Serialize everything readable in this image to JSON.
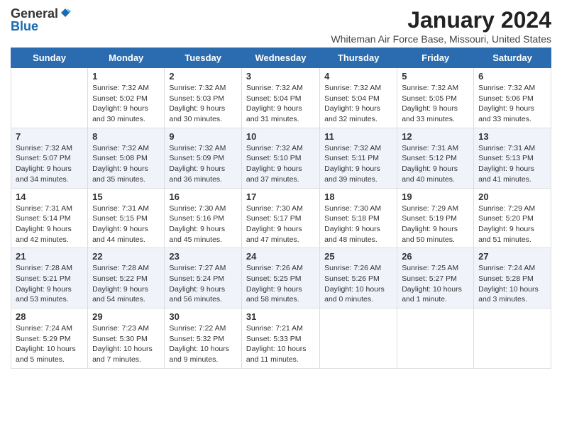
{
  "header": {
    "logo_general": "General",
    "logo_blue": "Blue",
    "title": "January 2024",
    "subtitle": "Whiteman Air Force Base, Missouri, United States"
  },
  "columns": [
    "Sunday",
    "Monday",
    "Tuesday",
    "Wednesday",
    "Thursday",
    "Friday",
    "Saturday"
  ],
  "weeks": [
    {
      "days": [
        {
          "number": "",
          "info": ""
        },
        {
          "number": "1",
          "info": "Sunrise: 7:32 AM\nSunset: 5:02 PM\nDaylight: 9 hours\nand 30 minutes."
        },
        {
          "number": "2",
          "info": "Sunrise: 7:32 AM\nSunset: 5:03 PM\nDaylight: 9 hours\nand 30 minutes."
        },
        {
          "number": "3",
          "info": "Sunrise: 7:32 AM\nSunset: 5:04 PM\nDaylight: 9 hours\nand 31 minutes."
        },
        {
          "number": "4",
          "info": "Sunrise: 7:32 AM\nSunset: 5:04 PM\nDaylight: 9 hours\nand 32 minutes."
        },
        {
          "number": "5",
          "info": "Sunrise: 7:32 AM\nSunset: 5:05 PM\nDaylight: 9 hours\nand 33 minutes."
        },
        {
          "number": "6",
          "info": "Sunrise: 7:32 AM\nSunset: 5:06 PM\nDaylight: 9 hours\nand 33 minutes."
        }
      ]
    },
    {
      "days": [
        {
          "number": "7",
          "info": "Sunrise: 7:32 AM\nSunset: 5:07 PM\nDaylight: 9 hours\nand 34 minutes."
        },
        {
          "number": "8",
          "info": "Sunrise: 7:32 AM\nSunset: 5:08 PM\nDaylight: 9 hours\nand 35 minutes."
        },
        {
          "number": "9",
          "info": "Sunrise: 7:32 AM\nSunset: 5:09 PM\nDaylight: 9 hours\nand 36 minutes."
        },
        {
          "number": "10",
          "info": "Sunrise: 7:32 AM\nSunset: 5:10 PM\nDaylight: 9 hours\nand 37 minutes."
        },
        {
          "number": "11",
          "info": "Sunrise: 7:32 AM\nSunset: 5:11 PM\nDaylight: 9 hours\nand 39 minutes."
        },
        {
          "number": "12",
          "info": "Sunrise: 7:31 AM\nSunset: 5:12 PM\nDaylight: 9 hours\nand 40 minutes."
        },
        {
          "number": "13",
          "info": "Sunrise: 7:31 AM\nSunset: 5:13 PM\nDaylight: 9 hours\nand 41 minutes."
        }
      ]
    },
    {
      "days": [
        {
          "number": "14",
          "info": "Sunrise: 7:31 AM\nSunset: 5:14 PM\nDaylight: 9 hours\nand 42 minutes."
        },
        {
          "number": "15",
          "info": "Sunrise: 7:31 AM\nSunset: 5:15 PM\nDaylight: 9 hours\nand 44 minutes."
        },
        {
          "number": "16",
          "info": "Sunrise: 7:30 AM\nSunset: 5:16 PM\nDaylight: 9 hours\nand 45 minutes."
        },
        {
          "number": "17",
          "info": "Sunrise: 7:30 AM\nSunset: 5:17 PM\nDaylight: 9 hours\nand 47 minutes."
        },
        {
          "number": "18",
          "info": "Sunrise: 7:30 AM\nSunset: 5:18 PM\nDaylight: 9 hours\nand 48 minutes."
        },
        {
          "number": "19",
          "info": "Sunrise: 7:29 AM\nSunset: 5:19 PM\nDaylight: 9 hours\nand 50 minutes."
        },
        {
          "number": "20",
          "info": "Sunrise: 7:29 AM\nSunset: 5:20 PM\nDaylight: 9 hours\nand 51 minutes."
        }
      ]
    },
    {
      "days": [
        {
          "number": "21",
          "info": "Sunrise: 7:28 AM\nSunset: 5:21 PM\nDaylight: 9 hours\nand 53 minutes."
        },
        {
          "number": "22",
          "info": "Sunrise: 7:28 AM\nSunset: 5:22 PM\nDaylight: 9 hours\nand 54 minutes."
        },
        {
          "number": "23",
          "info": "Sunrise: 7:27 AM\nSunset: 5:24 PM\nDaylight: 9 hours\nand 56 minutes."
        },
        {
          "number": "24",
          "info": "Sunrise: 7:26 AM\nSunset: 5:25 PM\nDaylight: 9 hours\nand 58 minutes."
        },
        {
          "number": "25",
          "info": "Sunrise: 7:26 AM\nSunset: 5:26 PM\nDaylight: 10 hours\nand 0 minutes."
        },
        {
          "number": "26",
          "info": "Sunrise: 7:25 AM\nSunset: 5:27 PM\nDaylight: 10 hours\nand 1 minute."
        },
        {
          "number": "27",
          "info": "Sunrise: 7:24 AM\nSunset: 5:28 PM\nDaylight: 10 hours\nand 3 minutes."
        }
      ]
    },
    {
      "days": [
        {
          "number": "28",
          "info": "Sunrise: 7:24 AM\nSunset: 5:29 PM\nDaylight: 10 hours\nand 5 minutes."
        },
        {
          "number": "29",
          "info": "Sunrise: 7:23 AM\nSunset: 5:30 PM\nDaylight: 10 hours\nand 7 minutes."
        },
        {
          "number": "30",
          "info": "Sunrise: 7:22 AM\nSunset: 5:32 PM\nDaylight: 10 hours\nand 9 minutes."
        },
        {
          "number": "31",
          "info": "Sunrise: 7:21 AM\nSunset: 5:33 PM\nDaylight: 10 hours\nand 11 minutes."
        },
        {
          "number": "",
          "info": ""
        },
        {
          "number": "",
          "info": ""
        },
        {
          "number": "",
          "info": ""
        }
      ]
    }
  ]
}
